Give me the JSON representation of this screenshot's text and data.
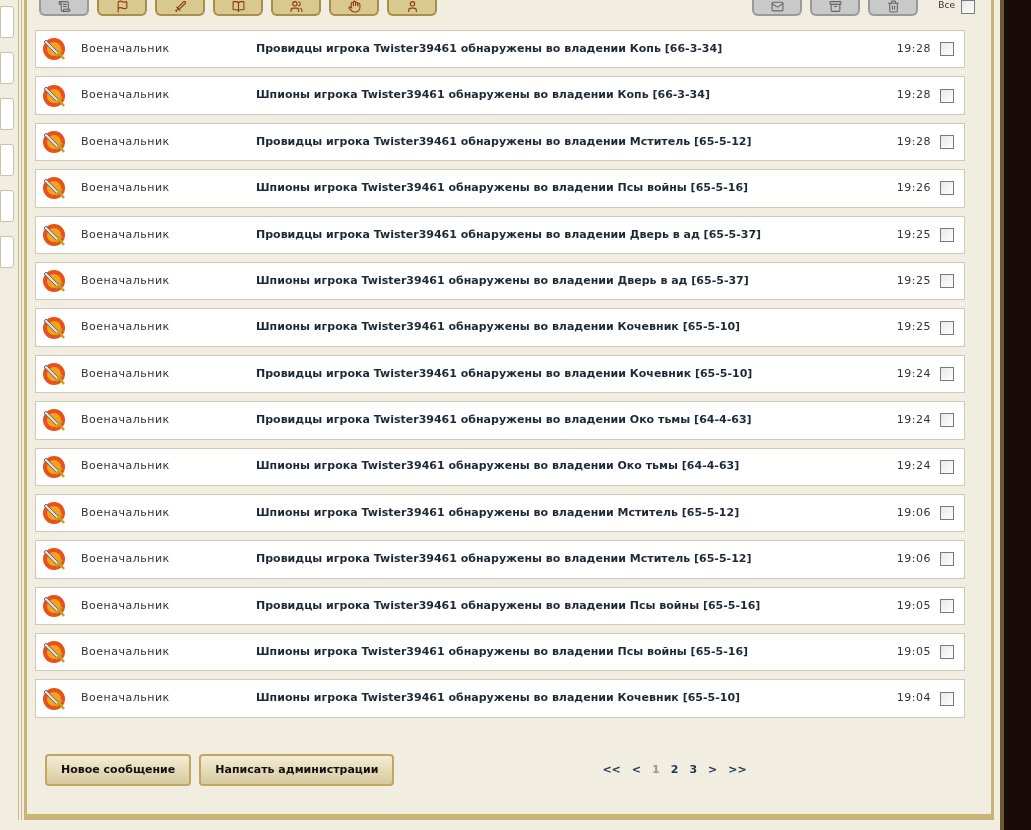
{
  "toolbar": {
    "left_buttons": [
      {
        "kind": "scroll"
      },
      {
        "kind": "flag"
      },
      {
        "kind": "sword"
      },
      {
        "kind": "book"
      },
      {
        "kind": "people"
      },
      {
        "kind": "hand"
      },
      {
        "kind": "warrior"
      }
    ],
    "right_buttons": [
      {
        "kind": "mail"
      },
      {
        "kind": "archive"
      },
      {
        "kind": "trash"
      }
    ],
    "select_all": {
      "label": "Все",
      "checked": false
    }
  },
  "messages": [
    {
      "sender": "Военачальник",
      "subject": "Провидцы игрока Twister39461 обнаружены во владении Копь [66-3-34]",
      "time": "19:28",
      "checked": false
    },
    {
      "sender": "Военачальник",
      "subject": "Шпионы игрока Twister39461 обнаружены во владении Копь [66-3-34]",
      "time": "19:28",
      "checked": false
    },
    {
      "sender": "Военачальник",
      "subject": "Провидцы игрока Twister39461 обнаружены во владении Мститель [65-5-12]",
      "time": "19:28",
      "checked": false
    },
    {
      "sender": "Военачальник",
      "subject": "Шпионы игрока Twister39461 обнаружены во владении Псы войны [65-5-16]",
      "time": "19:26",
      "checked": false
    },
    {
      "sender": "Военачальник",
      "subject": "Провидцы игрока Twister39461 обнаружены во владении Дверь в ад [65-5-37]",
      "time": "19:25",
      "checked": false
    },
    {
      "sender": "Военачальник",
      "subject": "Шпионы игрока Twister39461 обнаружены во владении Дверь в ад [65-5-37]",
      "time": "19:25",
      "checked": false
    },
    {
      "sender": "Военачальник",
      "subject": "Шпионы игрока Twister39461 обнаружены во владении Кочевник [65-5-10]",
      "time": "19:25",
      "checked": false
    },
    {
      "sender": "Военачальник",
      "subject": "Провидцы игрока Twister39461 обнаружены во владении Кочевник [65-5-10]",
      "time": "19:24",
      "checked": false
    },
    {
      "sender": "Военачальник",
      "subject": "Провидцы игрока Twister39461 обнаружены во владении Око тьмы [64-4-63]",
      "time": "19:24",
      "checked": false
    },
    {
      "sender": "Военачальник",
      "subject": "Шпионы игрока Twister39461 обнаружены во владении Око тьмы [64-4-63]",
      "time": "19:24",
      "checked": false
    },
    {
      "sender": "Военачальник",
      "subject": "Шпионы игрока Twister39461 обнаружены во владении Мститель [65-5-12]",
      "time": "19:06",
      "checked": false
    },
    {
      "sender": "Военачальник",
      "subject": "Провидцы игрока Twister39461 обнаружены во владении Мститель [65-5-12]",
      "time": "19:06",
      "checked": false
    },
    {
      "sender": "Военачальник",
      "subject": "Провидцы игрока Twister39461 обнаружены во владении Псы войны [65-5-16]",
      "time": "19:05",
      "checked": false
    },
    {
      "sender": "Военачальник",
      "subject": "Шпионы игрока Twister39461 обнаружены во владении Псы войны [65-5-16]",
      "time": "19:05",
      "checked": false
    },
    {
      "sender": "Военачальник",
      "subject": "Шпионы игрока Twister39461 обнаружены во владении Кочевник [65-5-10]",
      "time": "19:04",
      "checked": false
    }
  ],
  "buttons": [
    "Новое сообщение",
    "Написать администрации"
  ],
  "pagination": [
    {
      "label": "<<",
      "selected": false
    },
    {
      "label": "<",
      "selected": false
    },
    {
      "label": "1",
      "selected": true
    },
    {
      "label": "2",
      "selected": false
    },
    {
      "label": "3",
      "selected": false
    },
    {
      "label": ">",
      "selected": false
    },
    {
      "label": ">>",
      "selected": false
    }
  ]
}
